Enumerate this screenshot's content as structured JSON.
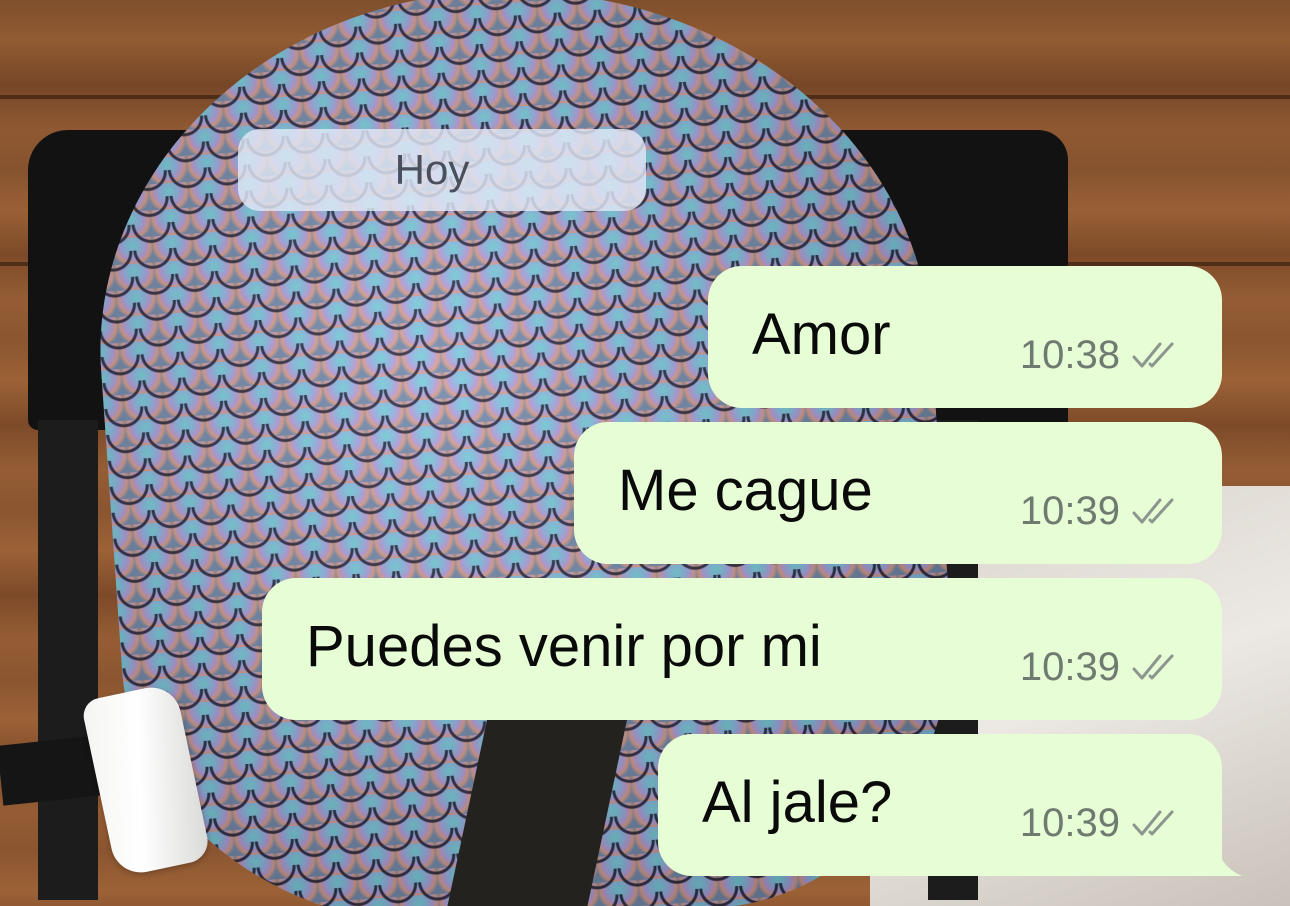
{
  "chat": {
    "date_separator": "Hoy",
    "messages": [
      {
        "text": "Amor",
        "time": "10:38",
        "status_icon": "double-check-icon"
      },
      {
        "text": "Me cague",
        "time": "10:39",
        "status_icon": "double-check-icon"
      },
      {
        "text": "Puedes venir por mi",
        "time": "10:39",
        "status_icon": "double-check-icon"
      },
      {
        "text": "Al jale?",
        "time": "10:39",
        "status_icon": "double-check-icon"
      }
    ]
  },
  "colors": {
    "outgoing_bubble": "#e6fdd6",
    "date_pill": "#e1e8f5",
    "timestamp": "#6f7a70"
  }
}
